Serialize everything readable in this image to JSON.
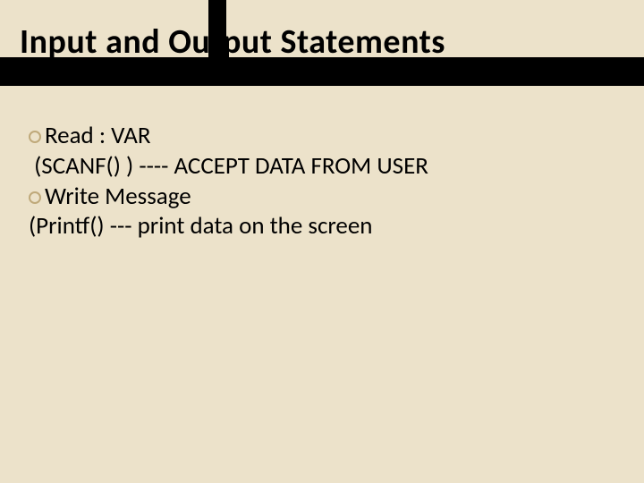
{
  "slide": {
    "title": "Input  and  Output  Statements",
    "bullets": [
      {
        "head": "Read : VAR",
        "sub": "(SCANF() )  ---- ACCEPT DATA FROM USER"
      },
      {
        "head": "Write Message",
        "sub": "(Printf()  ---  print data on the screen"
      }
    ]
  }
}
